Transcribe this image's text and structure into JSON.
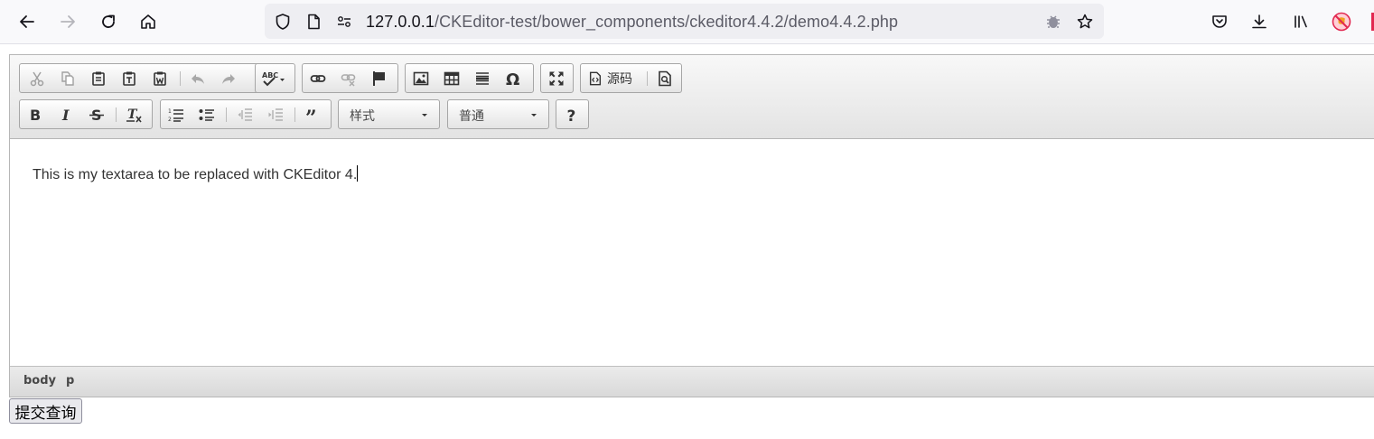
{
  "browser": {
    "url_host": "127.0.0.1",
    "url_path": "/CKEditor-test/bower_components/ckeditor4.4.2/demo4.4.2.php"
  },
  "toolbar": {
    "source_label": "源码",
    "styles_combo": "样式",
    "format_combo": "普通"
  },
  "editor": {
    "content": "This is my textarea to be replaced with CKEditor 4.",
    "path": [
      "body",
      "p"
    ]
  },
  "form": {
    "submit_label": "提交查询"
  },
  "colors": {
    "accent_bug": "#e22850",
    "toolbar_border": "#a6a6a6"
  }
}
